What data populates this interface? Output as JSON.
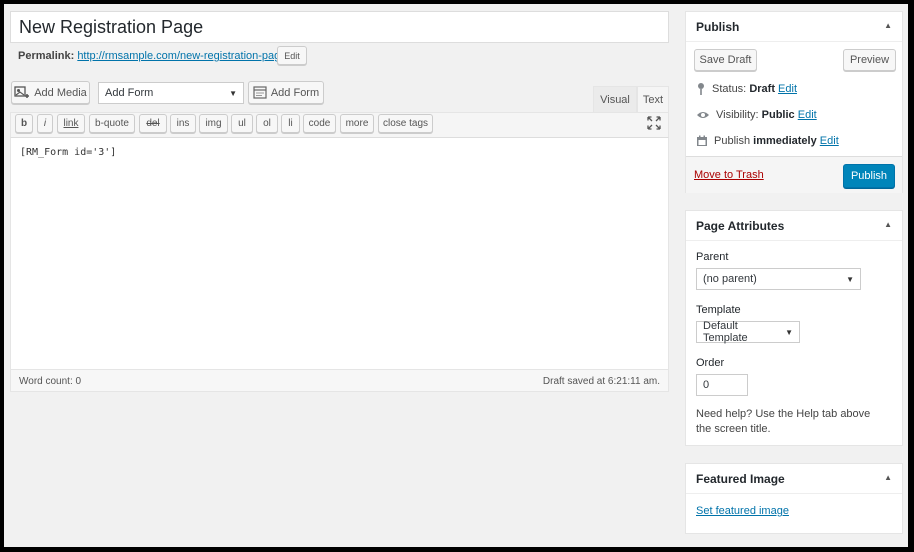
{
  "post": {
    "title": "New Registration Page",
    "permalink_label": "Permalink:",
    "permalink_url": "http://rmsample.com/new-registration-page/",
    "permalink_edit": "Edit"
  },
  "media_bar": {
    "add_media": "Add Media",
    "form_select": "Add Form",
    "add_form_button": "Add Form",
    "tab_visual": "Visual",
    "tab_text": "Text"
  },
  "quicktags": [
    "b",
    "i",
    "link",
    "b-quote",
    "del",
    "ins",
    "img",
    "ul",
    "ol",
    "li",
    "code",
    "more",
    "close tags"
  ],
  "editor": {
    "content": "[RM_Form id='3']",
    "word_count": "Word count: 0",
    "saved": "Draft saved at 6:21:11 am."
  },
  "publish": {
    "title": "Publish",
    "save_draft": "Save Draft",
    "preview": "Preview",
    "status_label": "Status:",
    "status_value": "Draft",
    "visibility_label": "Visibility:",
    "visibility_value": "Public",
    "schedule_label": "Publish",
    "schedule_value": "immediately",
    "edit": "Edit",
    "trash": "Move to Trash",
    "publish_button": "Publish"
  },
  "page_attributes": {
    "title": "Page Attributes",
    "parent_label": "Parent",
    "parent_value": "(no parent)",
    "template_label": "Template",
    "template_value": "Default Template",
    "order_label": "Order",
    "order_value": "0",
    "help": "Need help? Use the Help tab above the screen title."
  },
  "featured_image": {
    "title": "Featured Image",
    "set_link": "Set featured image"
  }
}
